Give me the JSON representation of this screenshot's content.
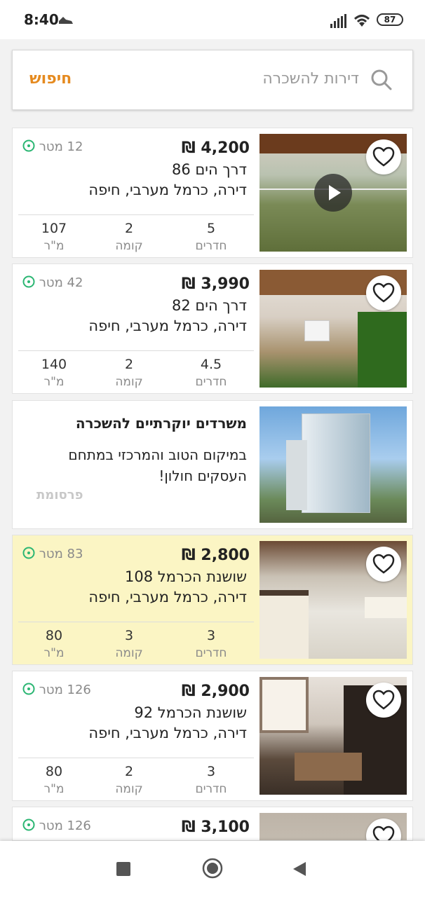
{
  "status_bar": {
    "time": "8:40",
    "battery": "87"
  },
  "search": {
    "placeholder": "דירות להשכרה",
    "action_label": "חיפוש"
  },
  "listings": [
    {
      "price": "4,200 ₪",
      "street": "דרך הים 86",
      "area": "דירה, כרמל מערבי, חיפה",
      "distance": "12 מטר",
      "has_video": true,
      "highlighted": false,
      "rooms_value": "5",
      "rooms_label": "חדרים",
      "floor_value": "2",
      "floor_label": "קומה",
      "size_value": "107",
      "size_label": "מ\"ר"
    },
    {
      "price": "3,990 ₪",
      "street": "דרך הים 82",
      "area": "דירה, כרמל מערבי, חיפה",
      "distance": "42 מטר",
      "has_video": false,
      "highlighted": false,
      "rooms_value": "4.5",
      "rooms_label": "חדרים",
      "floor_value": "2",
      "floor_label": "קומה",
      "size_value": "140",
      "size_label": "מ\"ר"
    },
    {
      "price": "2,800 ₪",
      "street": "שושנת הכרמל 108",
      "area": "דירה, כרמל מערבי, חיפה",
      "distance": "83 מטר",
      "has_video": false,
      "highlighted": true,
      "rooms_value": "3",
      "rooms_label": "חדרים",
      "floor_value": "3",
      "floor_label": "קומה",
      "size_value": "80",
      "size_label": "מ\"ר"
    },
    {
      "price": "2,900 ₪",
      "street": "שושנת הכרמל 92",
      "area": "דירה, כרמל מערבי, חיפה",
      "distance": "126 מטר",
      "has_video": false,
      "highlighted": false,
      "rooms_value": "3",
      "rooms_label": "חדרים",
      "floor_value": "2",
      "floor_label": "קומה",
      "size_value": "80",
      "size_label": "מ\"ר"
    },
    {
      "price": "3,100 ₪",
      "distance": "126 מטר"
    }
  ],
  "ad": {
    "title": "משרדים יוקרתיים להשכרה",
    "body": "במיקום הטוב והמרכזי במתחם העסקים חולון!",
    "tag": "פרסומת"
  },
  "colors": {
    "accent": "#e58a1f",
    "highlight": "#fbf5c4",
    "distance_icon": "#2bb673"
  }
}
